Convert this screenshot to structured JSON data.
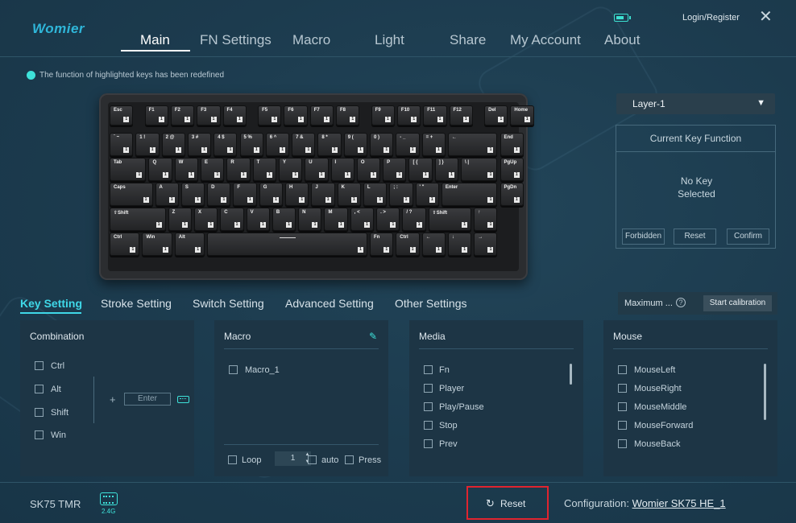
{
  "brand": "Womier",
  "nav": {
    "items": [
      "Main",
      "FN Settings",
      "Macro",
      "Light",
      "Share",
      "My Account",
      "About"
    ],
    "active": "Main"
  },
  "header": {
    "login": "Login/Register",
    "close": "✕"
  },
  "notice": "The function of highlighted keys has been redefined",
  "keyboard": {
    "badge": "1",
    "rows": [
      [
        "Esc",
        "F1",
        "F2",
        "F3",
        "F4",
        "F5",
        "F6",
        "F7",
        "F8",
        "F9",
        "F10",
        "F11",
        "F12",
        "Del",
        "Home"
      ],
      [
        "` ~",
        "1 !",
        "2 @",
        "3 #",
        "4 $",
        "5 %",
        "6 ^",
        "7 &",
        "8 *",
        "9 (",
        "0 )",
        "- _",
        "= +",
        "←",
        "End"
      ],
      [
        "Tab",
        "Q",
        "W",
        "E",
        "R",
        "T",
        "Y",
        "U",
        "I",
        "O",
        "P",
        "[ {",
        "] }",
        "\\ |",
        "PgUp"
      ],
      [
        "Caps",
        "A",
        "S",
        "D",
        "F",
        "G",
        "H",
        "J",
        "K",
        "L",
        "; :",
        "' \"",
        "Enter",
        "PgDn"
      ],
      [
        "⇧Shift",
        "Z",
        "X",
        "C",
        "V",
        "B",
        "N",
        "M",
        ", <",
        ". >",
        "/ ?",
        "⇧Shift",
        "↑"
      ],
      [
        "Ctrl",
        "Win",
        "Alt",
        "",
        "Fn",
        "Ctrl",
        "←",
        "↓",
        "→"
      ]
    ]
  },
  "layer": {
    "selected": "Layer-1",
    "arrow": "▼"
  },
  "current_key": {
    "title": "Current Key Function",
    "empty_line1": "No Key",
    "empty_line2": "Selected",
    "buttons": [
      "Forbidden",
      "Reset",
      "Confirm"
    ]
  },
  "tabs": {
    "items": [
      "Key Setting",
      "Stroke Setting",
      "Switch Setting",
      "Advanced Setting",
      "Other Settings"
    ],
    "active": "Key Setting"
  },
  "calibration": {
    "max_label": "Maximum ...",
    "help": "?",
    "button": "Start calibration"
  },
  "combination": {
    "title": "Combination",
    "modifiers": [
      "Ctrl",
      "Alt",
      "Shift",
      "Win"
    ],
    "plus": "+",
    "input_placeholder": "Enter"
  },
  "macro": {
    "title": "Macro",
    "items": [
      "Macro_1"
    ],
    "loop_label": "Loop",
    "loop_count": "1",
    "auto_label": "auto",
    "press_label": "Press"
  },
  "media": {
    "title": "Media",
    "items": [
      "Fn",
      "Player",
      "Play/Pause",
      "Stop",
      "Prev"
    ]
  },
  "mouse": {
    "title": "Mouse",
    "items": [
      "MouseLeft",
      "MouseRight",
      "MouseMiddle",
      "MouseForward",
      "MouseBack"
    ]
  },
  "footer": {
    "model": "SK75 TMR",
    "connection": "2.4G",
    "reset": "Reset",
    "config_label": "Configuration:",
    "config_value": "Womier SK75 HE_1"
  },
  "colors": {
    "accent": "#3fd8e8",
    "background": "#1b3a4d",
    "highlight_border": "#e0242f"
  },
  "icons": [
    "battery-icon",
    "close-icon",
    "dot-icon",
    "dropdown-arrow-icon",
    "help-icon",
    "pencil-icon",
    "keyboard-icon",
    "dongle-icon",
    "refresh-icon"
  ]
}
